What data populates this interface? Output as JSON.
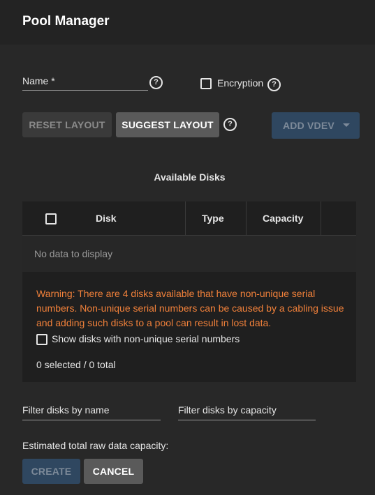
{
  "dialog": {
    "title": "Pool Manager"
  },
  "name_field": {
    "label": "Name *",
    "value": ""
  },
  "encryption": {
    "label": "Encryption",
    "checked": false
  },
  "buttons": {
    "reset_layout": "Reset Layout",
    "suggest_layout": "Suggest Layout",
    "add_vdev": "Add Vdev",
    "create": "Create",
    "cancel": "Cancel"
  },
  "available_disks": {
    "title": "Available Disks",
    "columns": [
      "Disk",
      "Type",
      "Capacity"
    ],
    "empty_text": "No data to display",
    "warning": "Warning: There are 4 disks available that have non-unique serial numbers. Non-unique serial numbers can be caused by a cabling issue and adding such disks to a pool can result in lost data.",
    "show_nonunique_label": "Show disks with non-unique serial numbers",
    "selection_summary": "0 selected / 0 total"
  },
  "filters": {
    "by_name": "Filter disks by name",
    "by_capacity": "Filter disks by capacity"
  },
  "estimated_capacity_label": "Estimated total raw data capacity:",
  "colors": {
    "background": "#282828",
    "warning": "#f0803a",
    "primary_disabled": "#2f4760"
  }
}
